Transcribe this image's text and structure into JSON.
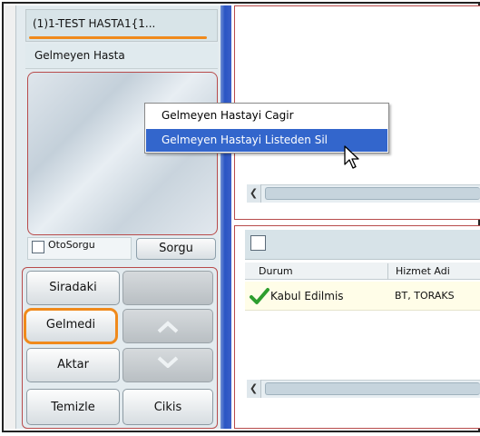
{
  "left_panel": {
    "top_item": "(1)1-TEST HASTA1{1...",
    "section_label": "Gelmeyen Hasta",
    "oto_sorgu_label": "OtoSorgu",
    "sorgu_button": "Sorgu",
    "buttons": {
      "siradaki": "Siradaki",
      "gelmedi": "Gelmedi",
      "aktar": "Aktar",
      "temizle": "Temizle",
      "cikis": "Cikis"
    }
  },
  "context_menu": {
    "items": [
      {
        "label": "Gelmeyen Hastayi Cagir"
      },
      {
        "label": "Gelmeyen Hastayi Listeden Sil",
        "highlighted": true
      }
    ]
  },
  "grid": {
    "columns": [
      "Durum",
      "Hizmet Adi"
    ],
    "rows": [
      {
        "durum": "Kabul Edilmis",
        "hizmet": "BT, TORAKS",
        "status_icon": "green-check-icon"
      }
    ]
  },
  "colors": {
    "highlight_orange": "#f08a1c",
    "menu_selection": "#3366cc",
    "panel_border_red": "#b84b4b",
    "side_blue": "#2b55c4"
  }
}
